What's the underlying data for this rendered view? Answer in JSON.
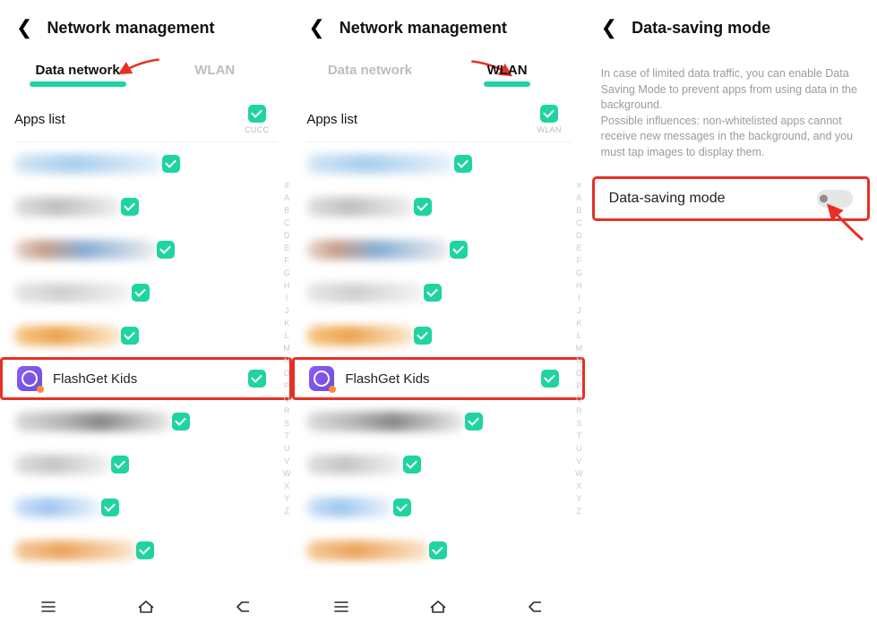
{
  "panel1": {
    "header_title": "Network management",
    "tabs": {
      "data": "Data network",
      "wlan": "WLAN",
      "active": "data"
    },
    "apps_list_label": "Apps list",
    "col_caption": "CUCC",
    "highlighted_app": "FlashGet Kids"
  },
  "panel2": {
    "header_title": "Network management",
    "tabs": {
      "data": "Data network",
      "wlan": "WLAN",
      "active": "wlan"
    },
    "apps_list_label": "Apps list",
    "col_caption": "WLAN",
    "highlighted_app": "FlashGet Kids"
  },
  "panel3": {
    "header_title": "Data-saving mode",
    "description": "In case of limited data traffic, you can enable Data Saving Mode to prevent apps from using data in the background.\nPossible influences: non-whitelisted apps cannot receive new messages in the background, and you must tap images to display them.",
    "toggle_label": "Data-saving mode",
    "toggle_state": "off"
  },
  "alpha_index": [
    "#",
    "A",
    "B",
    "C",
    "D",
    "E",
    "F",
    "G",
    "H",
    "I",
    "J",
    "K",
    "L",
    "M",
    "N",
    "O",
    "P",
    "Q",
    "R",
    "S",
    "T",
    "U",
    "V",
    "W",
    "X",
    "Y",
    "Z"
  ],
  "colors": {
    "accent": "#1fd4a0",
    "highlight": "#e73025"
  },
  "blur_rows": [
    {
      "bg": "linear-gradient(90deg,#d6e8f5,#a8cfee 40%,#e9f2fa)",
      "w": "58%"
    },
    {
      "bg": "linear-gradient(90deg,#e0e0e0,#bfbfbf 40%,#f0f0f0)",
      "w": "42%"
    },
    {
      "bg": "linear-gradient(90deg,#e8d8d0,#c89f8a 20%,#88aed4 50%,#eee)",
      "w": "56%"
    },
    {
      "bg": "linear-gradient(90deg,#e7e7e7,#cfcfcf 40%,#f4f4f4)",
      "w": "46%"
    },
    {
      "bg": "linear-gradient(90deg,#f7c88a,#eca24c 40%,#fce9cf)",
      "w": "42%"
    },
    {
      "bg": "linear-gradient(90deg,#dcdcdc,#b5b5b5 30%,#888 55%,#eee)",
      "w": "62%"
    },
    {
      "bg": "linear-gradient(90deg,#e0e0e0,#c4c4c4 40%,#f3f3f3)",
      "w": "38%"
    },
    {
      "bg": "linear-gradient(90deg,#cfe2f8,#9fc6ef 40%,#eef5fc)",
      "w": "34%"
    },
    {
      "bg": "linear-gradient(90deg,#f5c99b,#eba35a 40%,#fbe6cf)",
      "w": "48%"
    }
  ]
}
